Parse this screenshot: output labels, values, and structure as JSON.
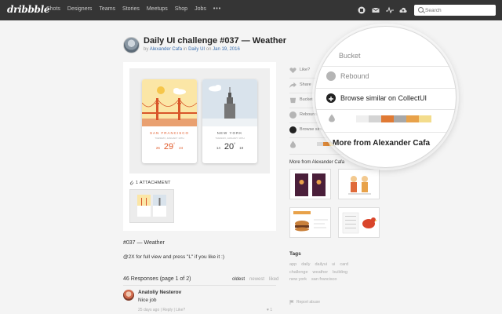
{
  "nav": {
    "logo": "dribbble",
    "items": [
      "Shots",
      "Designers",
      "Teams",
      "Stories",
      "Meetups",
      "Shop",
      "Jobs"
    ],
    "more": "•••",
    "icons": [
      "shield-icon",
      "mail-icon",
      "activity-icon",
      "upload-icon"
    ],
    "search_placeholder": "Search"
  },
  "shot": {
    "title": "Daily UI challenge #037 — Weather",
    "by": "by",
    "author": "Alexander Cafa",
    "in": "in",
    "team": "Daily UI",
    "on": "on",
    "date": "Jan 19, 2016",
    "cards": [
      {
        "city": "SAN FRANCISCO",
        "date": "TUESDAY, JANUARY 19TH",
        "low": "26",
        "temp": "29",
        "high": "24",
        "accent": "#e05a2a"
      },
      {
        "city": "NEW YORK",
        "date": "TUESDAY, JANUARY 19TH",
        "low": "14",
        "temp": "20",
        "high": "18",
        "accent": "#555555"
      }
    ],
    "attachments_label": "1 ATTACHMENT",
    "description_title": "#037 — Weather",
    "description_body": "@2X for full view and press \"L\" if you like it :)"
  },
  "responses": {
    "count_label": "46 Responses",
    "page_label": "(page 1 of 2)",
    "sort": [
      "oldest",
      "newest",
      "liked"
    ],
    "comments": [
      {
        "name": "Anatoliy Nesterov",
        "text": "Nice job",
        "meta": "25 days ago",
        "reply": "Reply",
        "like": "Like?",
        "likes": "1"
      }
    ]
  },
  "sidebar": {
    "actions": [
      "Like?",
      "Share",
      "Bucket",
      "Rebound",
      "Browse similar"
    ],
    "colors": [
      "#f4f4f4",
      "#d9d9d9",
      "#e08a3a",
      "#f5d88a",
      "#bdbdbd",
      "#e8c26a",
      "#f3e0a6"
    ],
    "more_from": "More from Alexander Cafa",
    "tags_heading": "Tags",
    "tags": [
      "app",
      "daily",
      "dailyui",
      "ui",
      "card",
      "challenge",
      "weather",
      "building",
      "new york",
      "san francisco"
    ],
    "report": "Report abuse"
  },
  "magnifier": {
    "bucket": "Bucket",
    "rebound": "Rebound",
    "browse": "Browse similar on CollectUI",
    "more_from": "More from Alexander Cafa"
  }
}
